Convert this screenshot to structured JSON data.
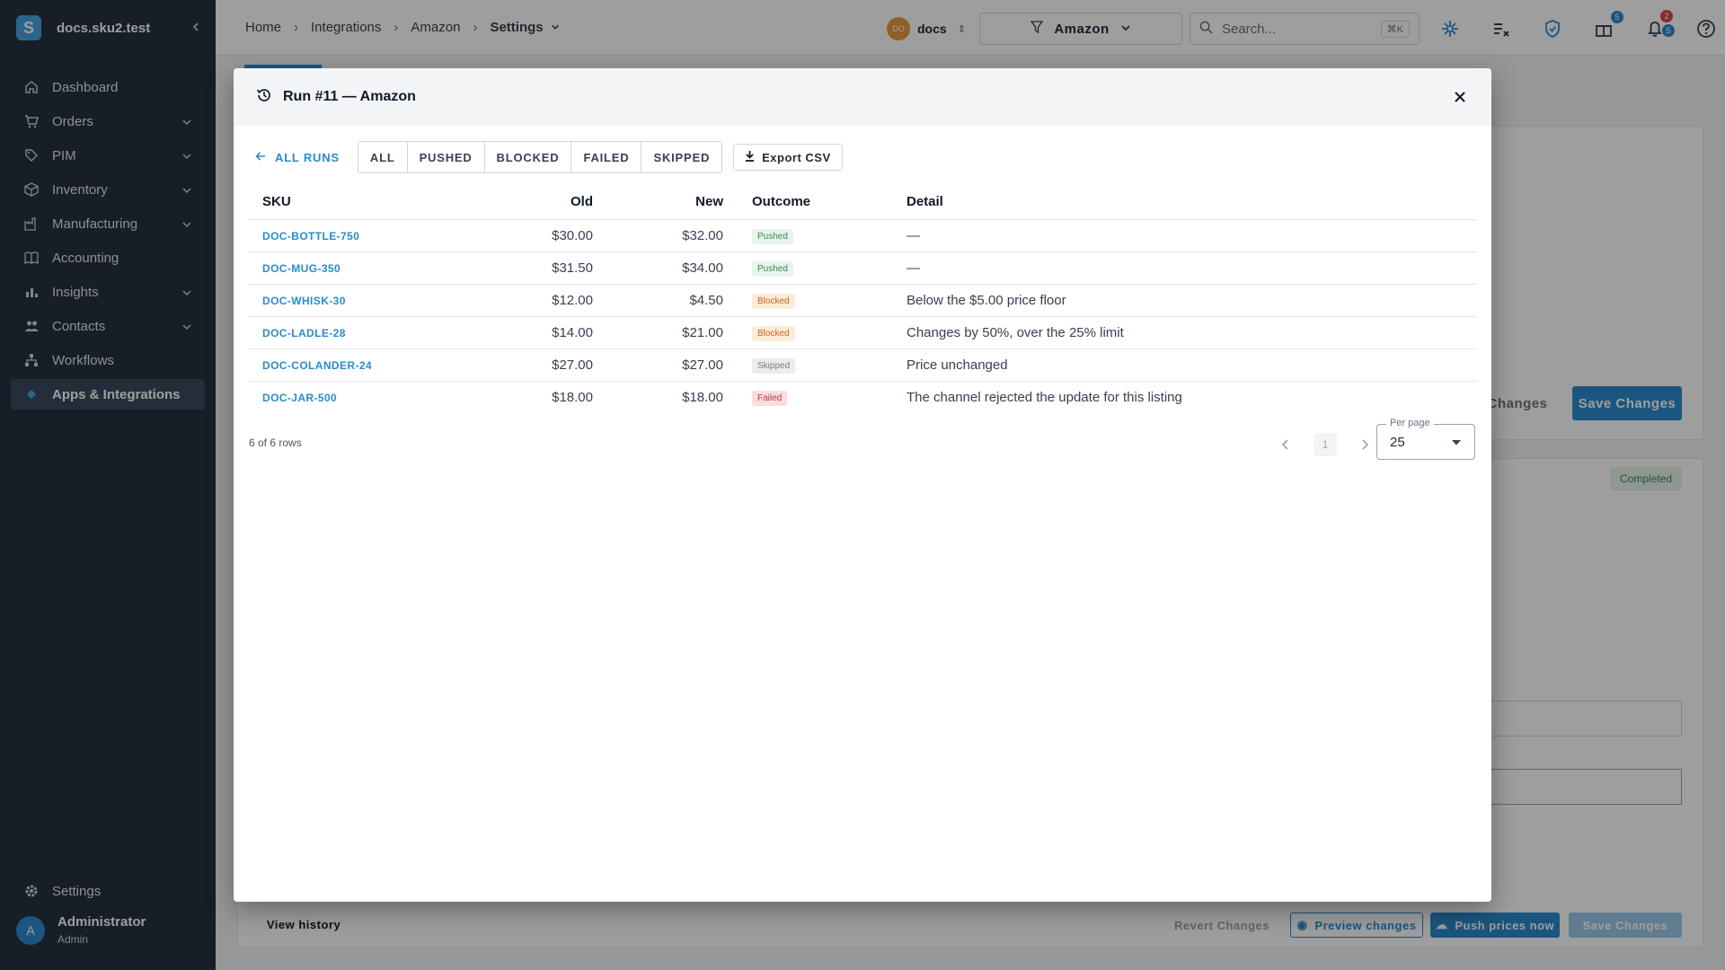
{
  "app": {
    "workspace_host": "docs.sku2.test",
    "logo_letter": "S"
  },
  "sidebar": {
    "items": [
      {
        "label": "Dashboard",
        "icon": "home-icon",
        "expandable": false
      },
      {
        "label": "Orders",
        "icon": "cart-icon",
        "expandable": true
      },
      {
        "label": "PIM",
        "icon": "tag-icon",
        "expandable": true
      },
      {
        "label": "Inventory",
        "icon": "box-icon",
        "expandable": true
      },
      {
        "label": "Manufacturing",
        "icon": "factory-icon",
        "expandable": true
      },
      {
        "label": "Accounting",
        "icon": "book-icon",
        "expandable": false
      },
      {
        "label": "Insights",
        "icon": "bar-chart-icon",
        "expandable": true
      },
      {
        "label": "Contacts",
        "icon": "people-icon",
        "expandable": true
      },
      {
        "label": "Workflows",
        "icon": "workflow-icon",
        "expandable": false
      },
      {
        "label": "Apps & Integrations",
        "icon": "apps-icon",
        "expandable": false,
        "active": true
      }
    ],
    "settings_label": "Settings",
    "user": {
      "initial": "A",
      "name": "Administrator",
      "role": "Admin"
    }
  },
  "topbar": {
    "breadcrumbs": [
      "Home",
      "Integrations",
      "Amazon",
      "Settings"
    ],
    "workspace": {
      "initials": "DO",
      "name": "docs"
    },
    "channel_filter": "Amazon",
    "search": {
      "placeholder": "Search...",
      "shortcut": "⌘K"
    },
    "badges": {
      "gifts": "5",
      "notifications_red": "2",
      "notifications_blue": "5"
    }
  },
  "background": {
    "revert_changes": "Revert Changes",
    "save_changes": "Save Changes",
    "partial_revert": "t Changes",
    "status": "Completed",
    "view_history": "View history",
    "preview_changes": "Preview changes",
    "push_prices_now": "Push prices now"
  },
  "dialog": {
    "title": "Run #11 — Amazon",
    "back_label": "ALL RUNS",
    "filters": [
      "ALL",
      "PUSHED",
      "BLOCKED",
      "FAILED",
      "SKIPPED"
    ],
    "export_label": "Export CSV",
    "columns": {
      "sku": "SKU",
      "old": "Old",
      "new": "New",
      "outcome": "Outcome",
      "detail": "Detail"
    },
    "rows": [
      {
        "sku": "DOC-BOTTLE-750",
        "old": "$30.00",
        "new": "$32.00",
        "outcome": "Pushed",
        "detail": "—"
      },
      {
        "sku": "DOC-MUG-350",
        "old": "$31.50",
        "new": "$34.00",
        "outcome": "Pushed",
        "detail": "—"
      },
      {
        "sku": "DOC-WHISK-30",
        "old": "$12.00",
        "new": "$4.50",
        "outcome": "Blocked",
        "detail": "Below the $5.00 price floor"
      },
      {
        "sku": "DOC-LADLE-28",
        "old": "$14.00",
        "new": "$21.00",
        "outcome": "Blocked",
        "detail": "Changes by 50%, over the 25% limit"
      },
      {
        "sku": "DOC-COLANDER-24",
        "old": "$27.00",
        "new": "$27.00",
        "outcome": "Skipped",
        "detail": "Price unchanged"
      },
      {
        "sku": "DOC-JAR-500",
        "old": "$18.00",
        "new": "$18.00",
        "outcome": "Failed",
        "detail": "The channel rejected the update for this listing"
      }
    ],
    "row_count": "6 of 6 rows",
    "current_page": "1",
    "per_page_label": "Per page",
    "per_page_value": "25"
  },
  "colors": {
    "accent": "#2a8bcd",
    "sidebar": "#243141",
    "pushed": "#3a8a4f",
    "blocked": "#c7671e",
    "failed": "#b83744"
  }
}
